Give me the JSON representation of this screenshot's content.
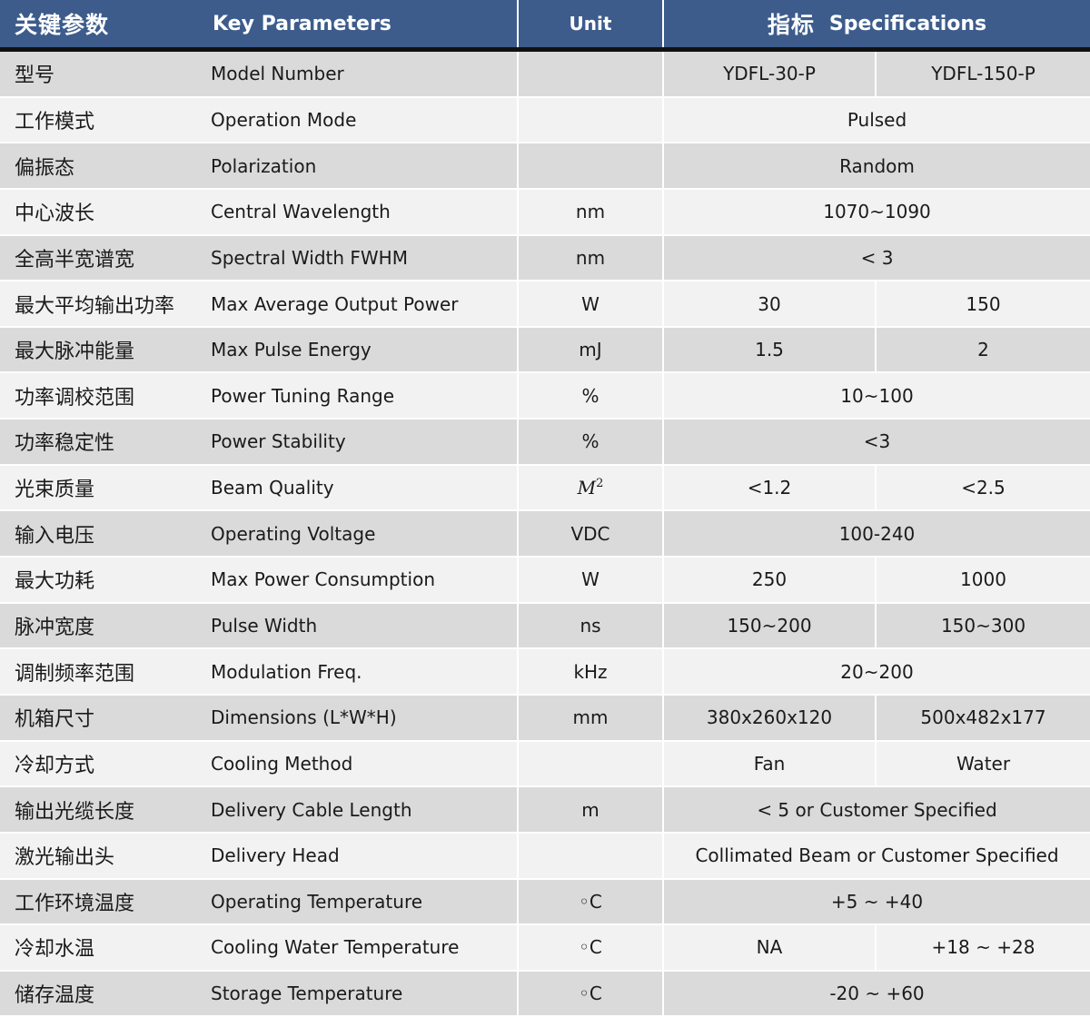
{
  "header": {
    "param_cn": "关键参数",
    "param_en": "Key  Parameters",
    "unit": "Unit",
    "spec_cn": "指标",
    "spec_en": "Specifications"
  },
  "rows": [
    {
      "cn": "型号",
      "en": "Model Number",
      "unit": "",
      "values": [
        "YDFL-30-P",
        "YDFL-150-P"
      ]
    },
    {
      "cn": "工作模式",
      "en": "Operation Mode",
      "unit": "",
      "values": [
        "Pulsed"
      ]
    },
    {
      "cn": "偏振态",
      "en": "Polarization",
      "unit": "",
      "values": [
        "Random"
      ]
    },
    {
      "cn": "中心波长",
      "en": "Central Wavelength",
      "unit": "nm",
      "values": [
        "1070~1090"
      ]
    },
    {
      "cn": "全高半宽谱宽",
      "en": "Spectral Width FWHM",
      "unit": "nm",
      "values": [
        "< 3"
      ]
    },
    {
      "cn": "最大平均输出功率",
      "en": "Max Average Output Power",
      "unit": "W",
      "values": [
        "30",
        "150"
      ]
    },
    {
      "cn": "最大脉冲能量",
      "en": "Max Pulse Energy",
      "unit": "mJ",
      "values": [
        "1.5",
        "2"
      ]
    },
    {
      "cn": "功率调校范围",
      "en": "Power Tuning Range",
      "unit": "%",
      "values": [
        "10~100"
      ]
    },
    {
      "cn": "功率稳定性",
      "en": "Power Stability",
      "unit": "%",
      "values": [
        "<3"
      ]
    },
    {
      "cn": "光束质量",
      "en": "Beam Quality",
      "unit": "M",
      "unit_sup": "2",
      "values": [
        "<1.2",
        "<2.5"
      ]
    },
    {
      "cn": "输入电压",
      "en": "Operating Voltage",
      "unit": "VDC",
      "values": [
        "100-240"
      ]
    },
    {
      "cn": "最大功耗",
      "en": "Max Power Consumption",
      "unit": "W",
      "values": [
        "250",
        "1000"
      ]
    },
    {
      "cn": "脉冲宽度",
      "en": "Pulse Width",
      "unit": "ns",
      "values": [
        "150~200",
        "150~300"
      ]
    },
    {
      "cn": "调制频率范围",
      "en": "Modulation Freq.",
      "unit": "kHz",
      "values": [
        "20~200"
      ]
    },
    {
      "cn": "机箱尺寸",
      "en": "Dimensions (L*W*H)",
      "unit": "mm",
      "values": [
        "380x260x120",
        "500x482x177"
      ]
    },
    {
      "cn": "冷却方式",
      "en": "Cooling Method",
      "unit": "",
      "values": [
        "Fan",
        "Water"
      ]
    },
    {
      "cn": "输出光缆长度",
      "en": "Delivery Cable Length",
      "unit": "m",
      "values": [
        "< 5 or Customer Specified"
      ]
    },
    {
      "cn": "激光输出头",
      "en": "Delivery Head",
      "unit": "",
      "values": [
        "Collimated Beam or Customer Specified"
      ]
    },
    {
      "cn": "工作环境温度",
      "en": "Operating Temperature",
      "unit": "◦C",
      "values": [
        "+5 ~ +40"
      ]
    },
    {
      "cn": "冷却水温",
      "en": "Cooling Water Temperature",
      "unit": "◦C",
      "values": [
        "NA",
        "+18 ~ +28"
      ]
    },
    {
      "cn": "储存温度",
      "en": "Storage  Temperature",
      "unit": "◦C",
      "values": [
        "-20 ~ +60"
      ]
    }
  ]
}
